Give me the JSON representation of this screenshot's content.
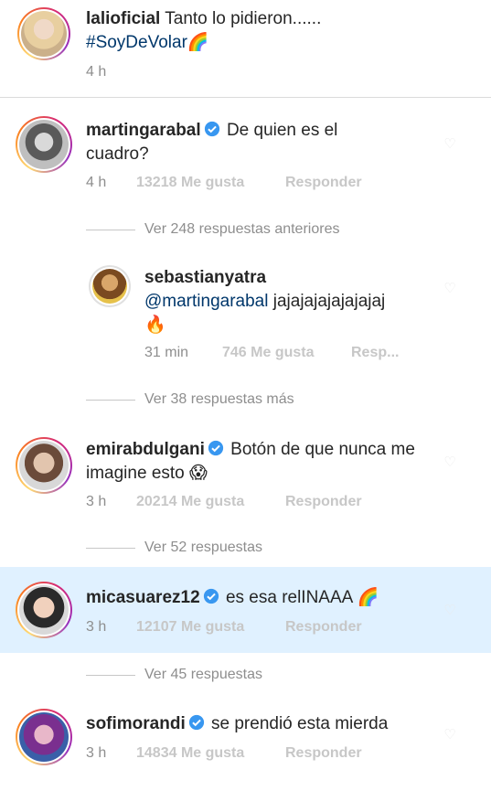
{
  "comments": [
    {
      "username": "lalioficial",
      "text": "Tanto lo pidieron......",
      "hashtag": "#SoyDeVolar",
      "emoji": "🌈",
      "time": "4 h"
    },
    {
      "username": "martingarabal",
      "verified": true,
      "text": "De quien es el cuadro?",
      "time": "4 h",
      "likes": "13218 Me gusta",
      "reply": "Responder"
    },
    {
      "username": "sebastianyatra",
      "mention": "@martingarabal",
      "text": "jajajajajajajajaj",
      "emoji": "🔥",
      "time": "31 min",
      "likes": "746 Me gusta",
      "reply": "Resp..."
    },
    {
      "username": "emirabdulgani",
      "verified": true,
      "text": "Botón de que nunca me imagine esto",
      "emoji": "😱",
      "time": "3 h",
      "likes": "20214 Me gusta",
      "reply": "Responder"
    },
    {
      "username": "micasuarez12",
      "verified": true,
      "text": "es esa relINAAA",
      "emoji": "🌈",
      "time": "3 h",
      "likes": "12107 Me gusta",
      "reply": "Responder"
    },
    {
      "username": "sofimorandi",
      "verified": true,
      "text": "se prendió esta mierda",
      "time": "3 h",
      "likes": "14834 Me gusta",
      "reply": "Responder"
    }
  ],
  "threads": {
    "previous": "Ver 248 respuestas anteriores",
    "more": "Ver 38 respuestas más",
    "emir_replies": "Ver 52 respuestas",
    "mica_replies": "Ver 45 respuestas"
  },
  "colors": {
    "highlight": "#e0f1ff",
    "verified": "#3897f0",
    "link": "#00376b",
    "meta": "#8e8e8e"
  }
}
